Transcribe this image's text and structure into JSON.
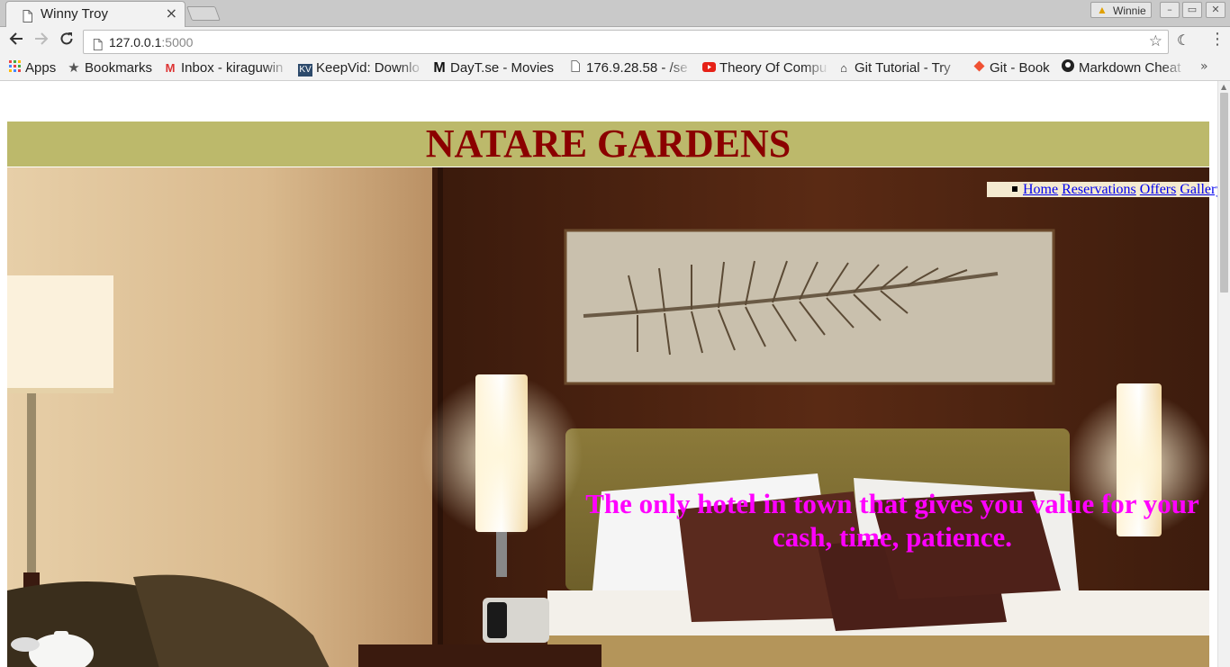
{
  "browser": {
    "tab_title": "Winny Troy",
    "tab_close": "×",
    "profile_name": "Winnie",
    "window_buttons": [
      "–",
      "▭",
      "✕"
    ],
    "url_host": "127.0.0.1",
    "url_port": ":5000",
    "bookmarks": [
      {
        "label": "Apps",
        "icon": "apps-grid-icon"
      },
      {
        "label": "Bookmarks",
        "icon": "star-icon"
      },
      {
        "label": "Inbox - kiraguwin",
        "icon": "gmail-icon"
      },
      {
        "label": "KeepVid: Downlo",
        "icon": "keepvid-icon"
      },
      {
        "label": "DayT.se - Movies",
        "icon": "dayt-icon"
      },
      {
        "label": "176.9.28.58 - /se",
        "icon": "page-icon"
      },
      {
        "label": "Theory Of Compu",
        "icon": "youtube-icon"
      },
      {
        "label": "Git Tutorial - Try",
        "icon": "octocat-icon"
      },
      {
        "label": "Git - Book",
        "icon": "git-icon"
      },
      {
        "label": "Markdown Cheat",
        "icon": "github-icon"
      }
    ],
    "bookmarks_more": "»"
  },
  "page": {
    "site_title": "NATARE GARDENS",
    "nav": {
      "home": "Home",
      "reservations": "Reservations",
      "offers": "Offers",
      "gallery": "Gallery"
    },
    "tagline": "The only hotel in town that gives you value for your cash, time, patience.",
    "hero_image": "hotel-bedroom-photo"
  },
  "colors": {
    "header_band": "#bcb96b",
    "title": "#8b0000",
    "tagline": "#ff00ff",
    "link": "#0000ee",
    "nav_bg": "#f4ead0"
  }
}
